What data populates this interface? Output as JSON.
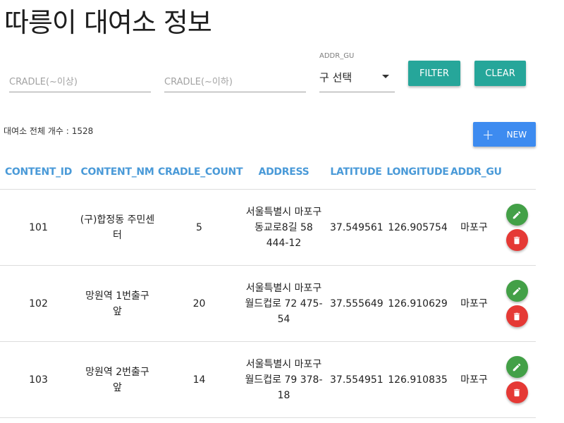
{
  "page": {
    "title": "따릉이 대여소 정보"
  },
  "filters": {
    "cradle_min_placeholder": "CRADLE(~이상)",
    "cradle_min_value": "",
    "cradle_max_placeholder": "CRADLE(~이하)",
    "cradle_max_value": "",
    "addr_gu_label": "ADDR_GU",
    "addr_gu_selected": "구 선택",
    "filter_button": "FILTER",
    "clear_button": "CLEAR"
  },
  "summary": {
    "label": "대여소 전체 개수 :",
    "total": "1528"
  },
  "new_button": {
    "icon": "plus-icon",
    "label": "NEW"
  },
  "table": {
    "columns": [
      "CONTENT_ID",
      "CONTENT_NM",
      "CRADLE_COUNT",
      "ADDRESS",
      "LATITUDE",
      "LONGITUDE",
      "ADDR_GU"
    ],
    "rows": [
      {
        "content_id": "101",
        "content_nm": "(구)합정동 주민센터",
        "cradle_count": "5",
        "address": "서울특별시 마포구 동교로8길 58 444-12",
        "latitude": "37.549561",
        "longitude": "126.905754",
        "addr_gu": "마포구"
      },
      {
        "content_id": "102",
        "content_nm": "망원역 1번출구 앞",
        "cradle_count": "20",
        "address": "서울특별시 마포구 월드컵로 72 475-54",
        "latitude": "37.555649",
        "longitude": "126.910629",
        "addr_gu": "마포구"
      },
      {
        "content_id": "103",
        "content_nm": "망원역 2번출구 앞",
        "cradle_count": "14",
        "address": "서울특별시 마포구 월드컵로 79 378-18",
        "latitude": "37.554951",
        "longitude": "126.910835",
        "addr_gu": "마포구"
      }
    ],
    "row_actions": {
      "edit_icon": "pencil-icon",
      "delete_icon": "trash-icon"
    }
  },
  "colors": {
    "filter_button": "#26a69a",
    "new_button": "#3d8bf0",
    "header_text": "#4a9ad8",
    "edit_button": "#43a047",
    "delete_button": "#e53935"
  }
}
